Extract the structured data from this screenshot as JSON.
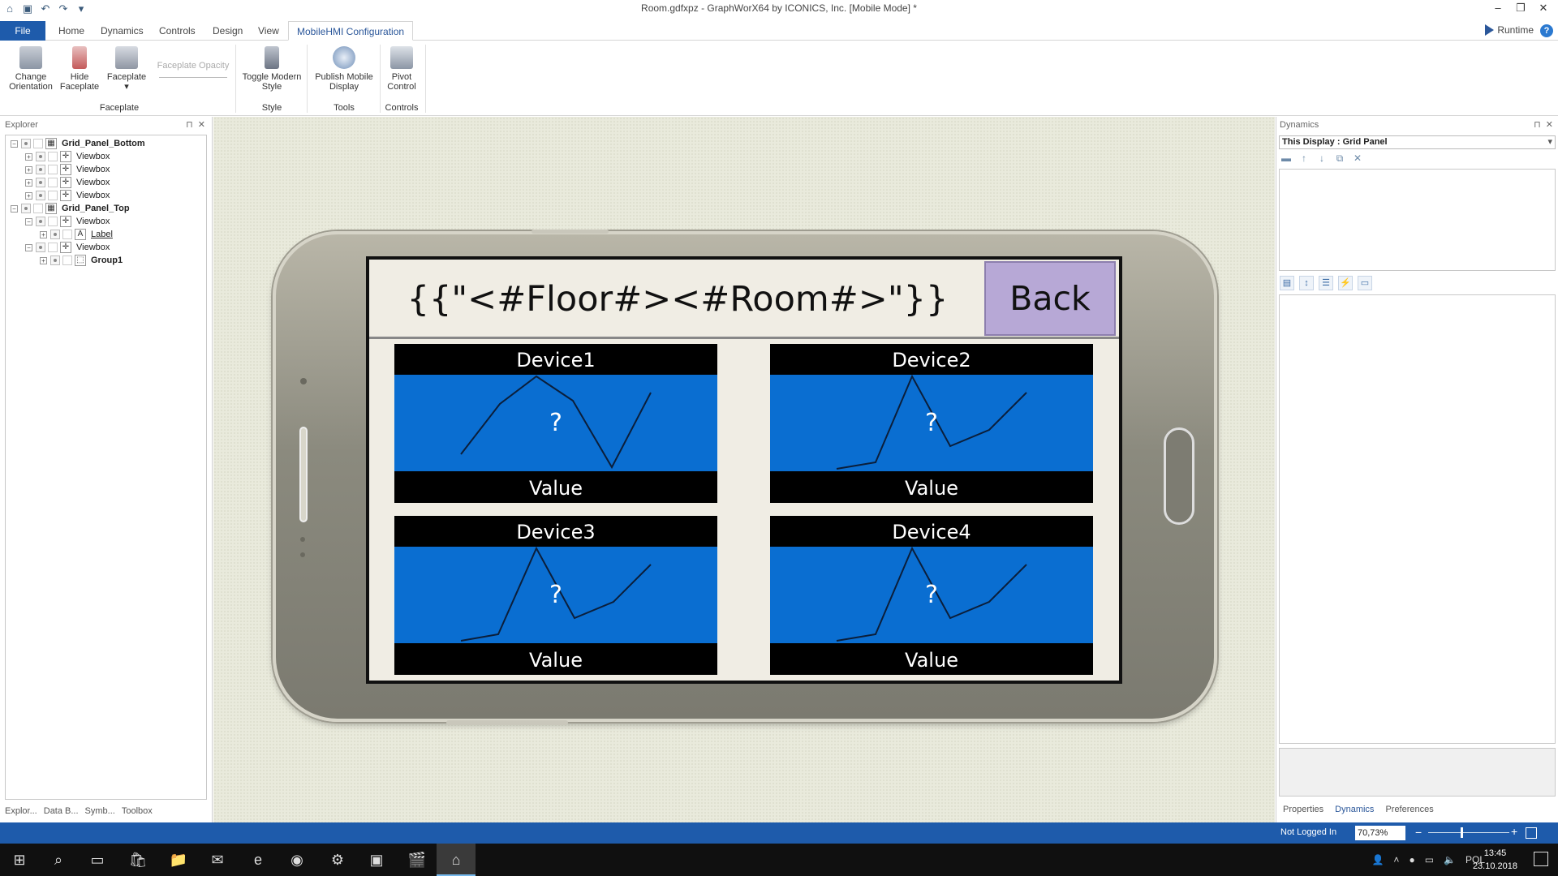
{
  "window": {
    "title": "Room.gdfxpz - GraphWorX64 by ICONICS, Inc. [Mobile Mode] *"
  },
  "ribbon": {
    "tabs": [
      "File",
      "Home",
      "Dynamics",
      "Controls",
      "Design",
      "View",
      "MobileHMI Configuration"
    ],
    "active_tab": "MobileHMI Configuration",
    "runtime_label": "Runtime",
    "help_label": "?",
    "buttons": {
      "change_orientation": "Change Orientation",
      "hide_faceplate": "Hide Faceplate",
      "faceplate": "Faceplate",
      "faceplate_opacity": "Faceplate Opacity",
      "toggle_modern_style": "Toggle Modern Style",
      "publish_mobile_display": "Publish Mobile Display",
      "pivot_control": "Pivot Control"
    },
    "groups": {
      "faceplate": "Faceplate",
      "style": "Style",
      "tools": "Tools",
      "controls": "Controls"
    }
  },
  "explorer": {
    "title": "Explorer",
    "tree": [
      {
        "label": "Grid_Panel_Bottom",
        "bold": true
      },
      {
        "label": "Viewbox"
      },
      {
        "label": "Viewbox"
      },
      {
        "label": "Viewbox"
      },
      {
        "label": "Viewbox"
      },
      {
        "label": "Grid_Panel_Top",
        "bold": true
      },
      {
        "label": "Viewbox"
      },
      {
        "label": "Label"
      },
      {
        "label": "Viewbox"
      },
      {
        "label": "Group1",
        "bold": true
      }
    ],
    "bottom_tabs": [
      "Explor...",
      "Data B...",
      "Symb...",
      "Toolbox"
    ]
  },
  "mobile_display": {
    "header_text": "{{\"<#Floor#><#Room#>\"}}",
    "back_button": "Back",
    "devices": [
      {
        "title": "Device1",
        "placeholder": "?",
        "value": "Value"
      },
      {
        "title": "Device2",
        "placeholder": "?",
        "value": "Value"
      },
      {
        "title": "Device3",
        "placeholder": "?",
        "value": "Value"
      },
      {
        "title": "Device4",
        "placeholder": "?",
        "value": "Value"
      }
    ]
  },
  "dynamics_panel": {
    "title": "Dynamics",
    "selector": "This Display : Grid Panel",
    "bottom_tabs": [
      "Properties",
      "Dynamics",
      "Preferences"
    ],
    "active_bottom_tab": "Dynamics"
  },
  "status": {
    "login": "Not Logged In",
    "zoom": "70,73%"
  },
  "taskbar": {
    "language": "POL",
    "time": "13:45",
    "date": "23.10.2018"
  }
}
